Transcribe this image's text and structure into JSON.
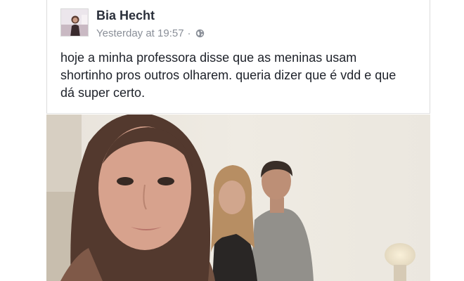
{
  "post": {
    "author": "Bia Hecht",
    "timestamp": "Yesterday at 19:57",
    "separator": "·",
    "privacy_icon": "globe-icon",
    "text": "hoje a minha professora disse que as meninas usam shortinho pros outros olharem. queria dizer que é vdd e que dá super certo."
  },
  "colors": {
    "name": "#2a2f3a",
    "meta": "#8a8f98",
    "text": "#1d2129"
  }
}
